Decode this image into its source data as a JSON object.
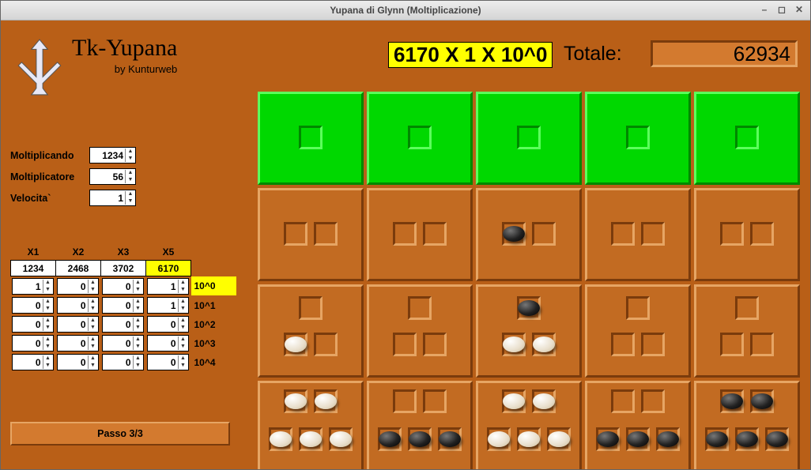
{
  "window": {
    "title": "Yupana di Glynn (Moltiplicazione)"
  },
  "app": {
    "name": "Tk-Yupana",
    "byline": "by Kunturweb"
  },
  "display": {
    "formula": "6170 X 1 X 10^0",
    "total_label": "Totale:",
    "total_value": "62934"
  },
  "inputs": [
    {
      "label": "Moltiplicando",
      "value": "1234"
    },
    {
      "label": "Moltiplicatore",
      "value": "56"
    },
    {
      "label": "Velocita`",
      "value": "1"
    }
  ],
  "sheet": {
    "headers": [
      "X1",
      "X2",
      "X3",
      "X5"
    ],
    "mult_row": [
      "1234",
      "2468",
      "3702",
      "6170"
    ],
    "mult_highlight": 3,
    "rows": [
      {
        "vals": [
          "1",
          "0",
          "0",
          "1"
        ],
        "label": "10^0",
        "hl": true
      },
      {
        "vals": [
          "0",
          "0",
          "0",
          "1"
        ],
        "label": "10^1",
        "hl": false
      },
      {
        "vals": [
          "0",
          "0",
          "0",
          "0"
        ],
        "label": "10^2",
        "hl": false
      },
      {
        "vals": [
          "0",
          "0",
          "0",
          "0"
        ],
        "label": "10^3",
        "hl": false
      },
      {
        "vals": [
          "0",
          "0",
          "0",
          "0"
        ],
        "label": "10^4",
        "hl": false
      }
    ]
  },
  "step_button": "Passo 3/3",
  "grid": {
    "layouts": {
      "1": [
        [
          49,
          40
        ]
      ],
      "2": [
        [
          30,
          40
        ],
        [
          68,
          40
        ]
      ],
      "3": [
        [
          49,
          12
        ],
        [
          30,
          58
        ],
        [
          68,
          58
        ]
      ],
      "5": [
        [
          30,
          8
        ],
        [
          68,
          8
        ],
        [
          11,
          56
        ],
        [
          49,
          56
        ],
        [
          87,
          56
        ]
      ]
    },
    "cells": [
      {
        "layout": "1",
        "green": true,
        "seeds": []
      },
      {
        "layout": "1",
        "green": true,
        "seeds": []
      },
      {
        "layout": "1",
        "green": true,
        "seeds": []
      },
      {
        "layout": "1",
        "green": true,
        "seeds": []
      },
      {
        "layout": "1",
        "green": true,
        "seeds": []
      },
      {
        "layout": "2",
        "seeds": []
      },
      {
        "layout": "2",
        "seeds": []
      },
      {
        "layout": "2",
        "seeds": [
          {
            "pos": 0,
            "color": "black"
          }
        ]
      },
      {
        "layout": "2",
        "seeds": []
      },
      {
        "layout": "2",
        "seeds": []
      },
      {
        "layout": "3",
        "seeds": [
          {
            "pos": 1,
            "color": "white"
          }
        ]
      },
      {
        "layout": "3",
        "seeds": []
      },
      {
        "layout": "3",
        "seeds": [
          {
            "pos": 0,
            "color": "black"
          },
          {
            "pos": 1,
            "color": "white"
          },
          {
            "pos": 2,
            "color": "white"
          }
        ]
      },
      {
        "layout": "3",
        "seeds": []
      },
      {
        "layout": "3",
        "seeds": []
      },
      {
        "layout": "5",
        "seeds": [
          {
            "pos": 0,
            "color": "white"
          },
          {
            "pos": 1,
            "color": "white"
          },
          {
            "pos": 2,
            "color": "white"
          },
          {
            "pos": 3,
            "color": "white"
          },
          {
            "pos": 4,
            "color": "white"
          }
        ]
      },
      {
        "layout": "5",
        "seeds": [
          {
            "pos": 2,
            "color": "black"
          },
          {
            "pos": 3,
            "color": "black"
          },
          {
            "pos": 4,
            "color": "black"
          }
        ]
      },
      {
        "layout": "5",
        "seeds": [
          {
            "pos": 0,
            "color": "white"
          },
          {
            "pos": 1,
            "color": "white"
          },
          {
            "pos": 2,
            "color": "white"
          },
          {
            "pos": 3,
            "color": "white"
          },
          {
            "pos": 4,
            "color": "white"
          }
        ]
      },
      {
        "layout": "5",
        "seeds": [
          {
            "pos": 2,
            "color": "black"
          },
          {
            "pos": 3,
            "color": "black"
          },
          {
            "pos": 4,
            "color": "black"
          }
        ]
      },
      {
        "layout": "5",
        "seeds": [
          {
            "pos": 0,
            "color": "black"
          },
          {
            "pos": 1,
            "color": "black"
          },
          {
            "pos": 2,
            "color": "black"
          },
          {
            "pos": 3,
            "color": "black"
          },
          {
            "pos": 4,
            "color": "black"
          }
        ]
      }
    ]
  }
}
